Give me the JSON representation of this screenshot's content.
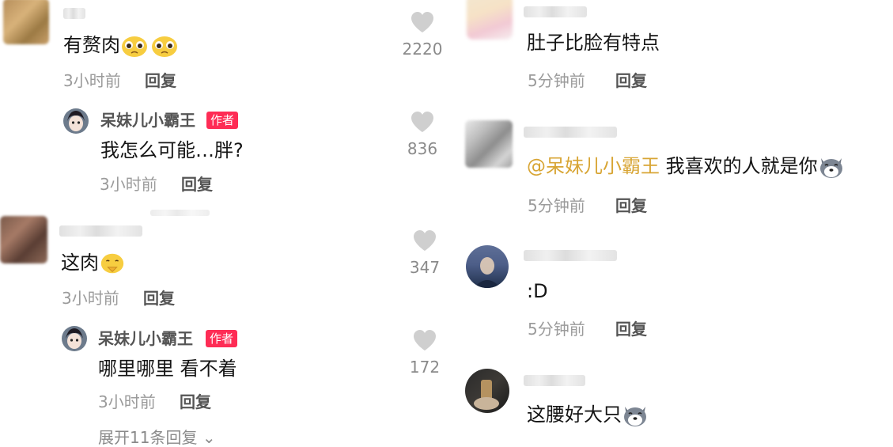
{
  "left_column": {
    "comment1": {
      "text": "有赘肉",
      "emoji": [
        "pleading-face-icon",
        "pleading-face-icon"
      ],
      "time": "3小时前",
      "reply": "回复",
      "author_reply": {
        "name": "呆妹儿小霸王",
        "badge": "作者",
        "text": "我怎么可能…胖?",
        "time": "3小时前",
        "reply": "回复"
      }
    },
    "comment2": {
      "text": "这肉",
      "emoji": [
        "praying-face-icon"
      ],
      "time": "3小时前",
      "reply": "回复",
      "author_reply": {
        "name": "呆妹儿小霸王",
        "badge": "作者",
        "text": "哪里哪里 看不着",
        "time": "3小时前",
        "reply": "回复"
      },
      "expand_text": "展开11条回复"
    }
  },
  "likes": [
    {
      "count": "2220"
    },
    {
      "count": "836"
    },
    {
      "count": "347"
    },
    {
      "count": "172"
    }
  ],
  "right_column": {
    "comment1": {
      "text": "肚子比脸有特点",
      "time": "5分钟前",
      "reply": "回复"
    },
    "comment2": {
      "mention": "@呆妹儿小霸王",
      "text": " 我喜欢的人就是你",
      "emoji": [
        "husky-dog-icon"
      ],
      "time": "5分钟前",
      "reply": "回复"
    },
    "comment3": {
      "text": ":D",
      "time": "5分钟前",
      "reply": "回复"
    },
    "comment4": {
      "text": "这腰好大只",
      "emoji": [
        "husky-dog-icon"
      ]
    }
  },
  "colors": {
    "badge": "#fe2c55",
    "mention": "#d8a534",
    "meta_gray": "#9b9b9b",
    "heart_gray": "#cfcfcf"
  }
}
